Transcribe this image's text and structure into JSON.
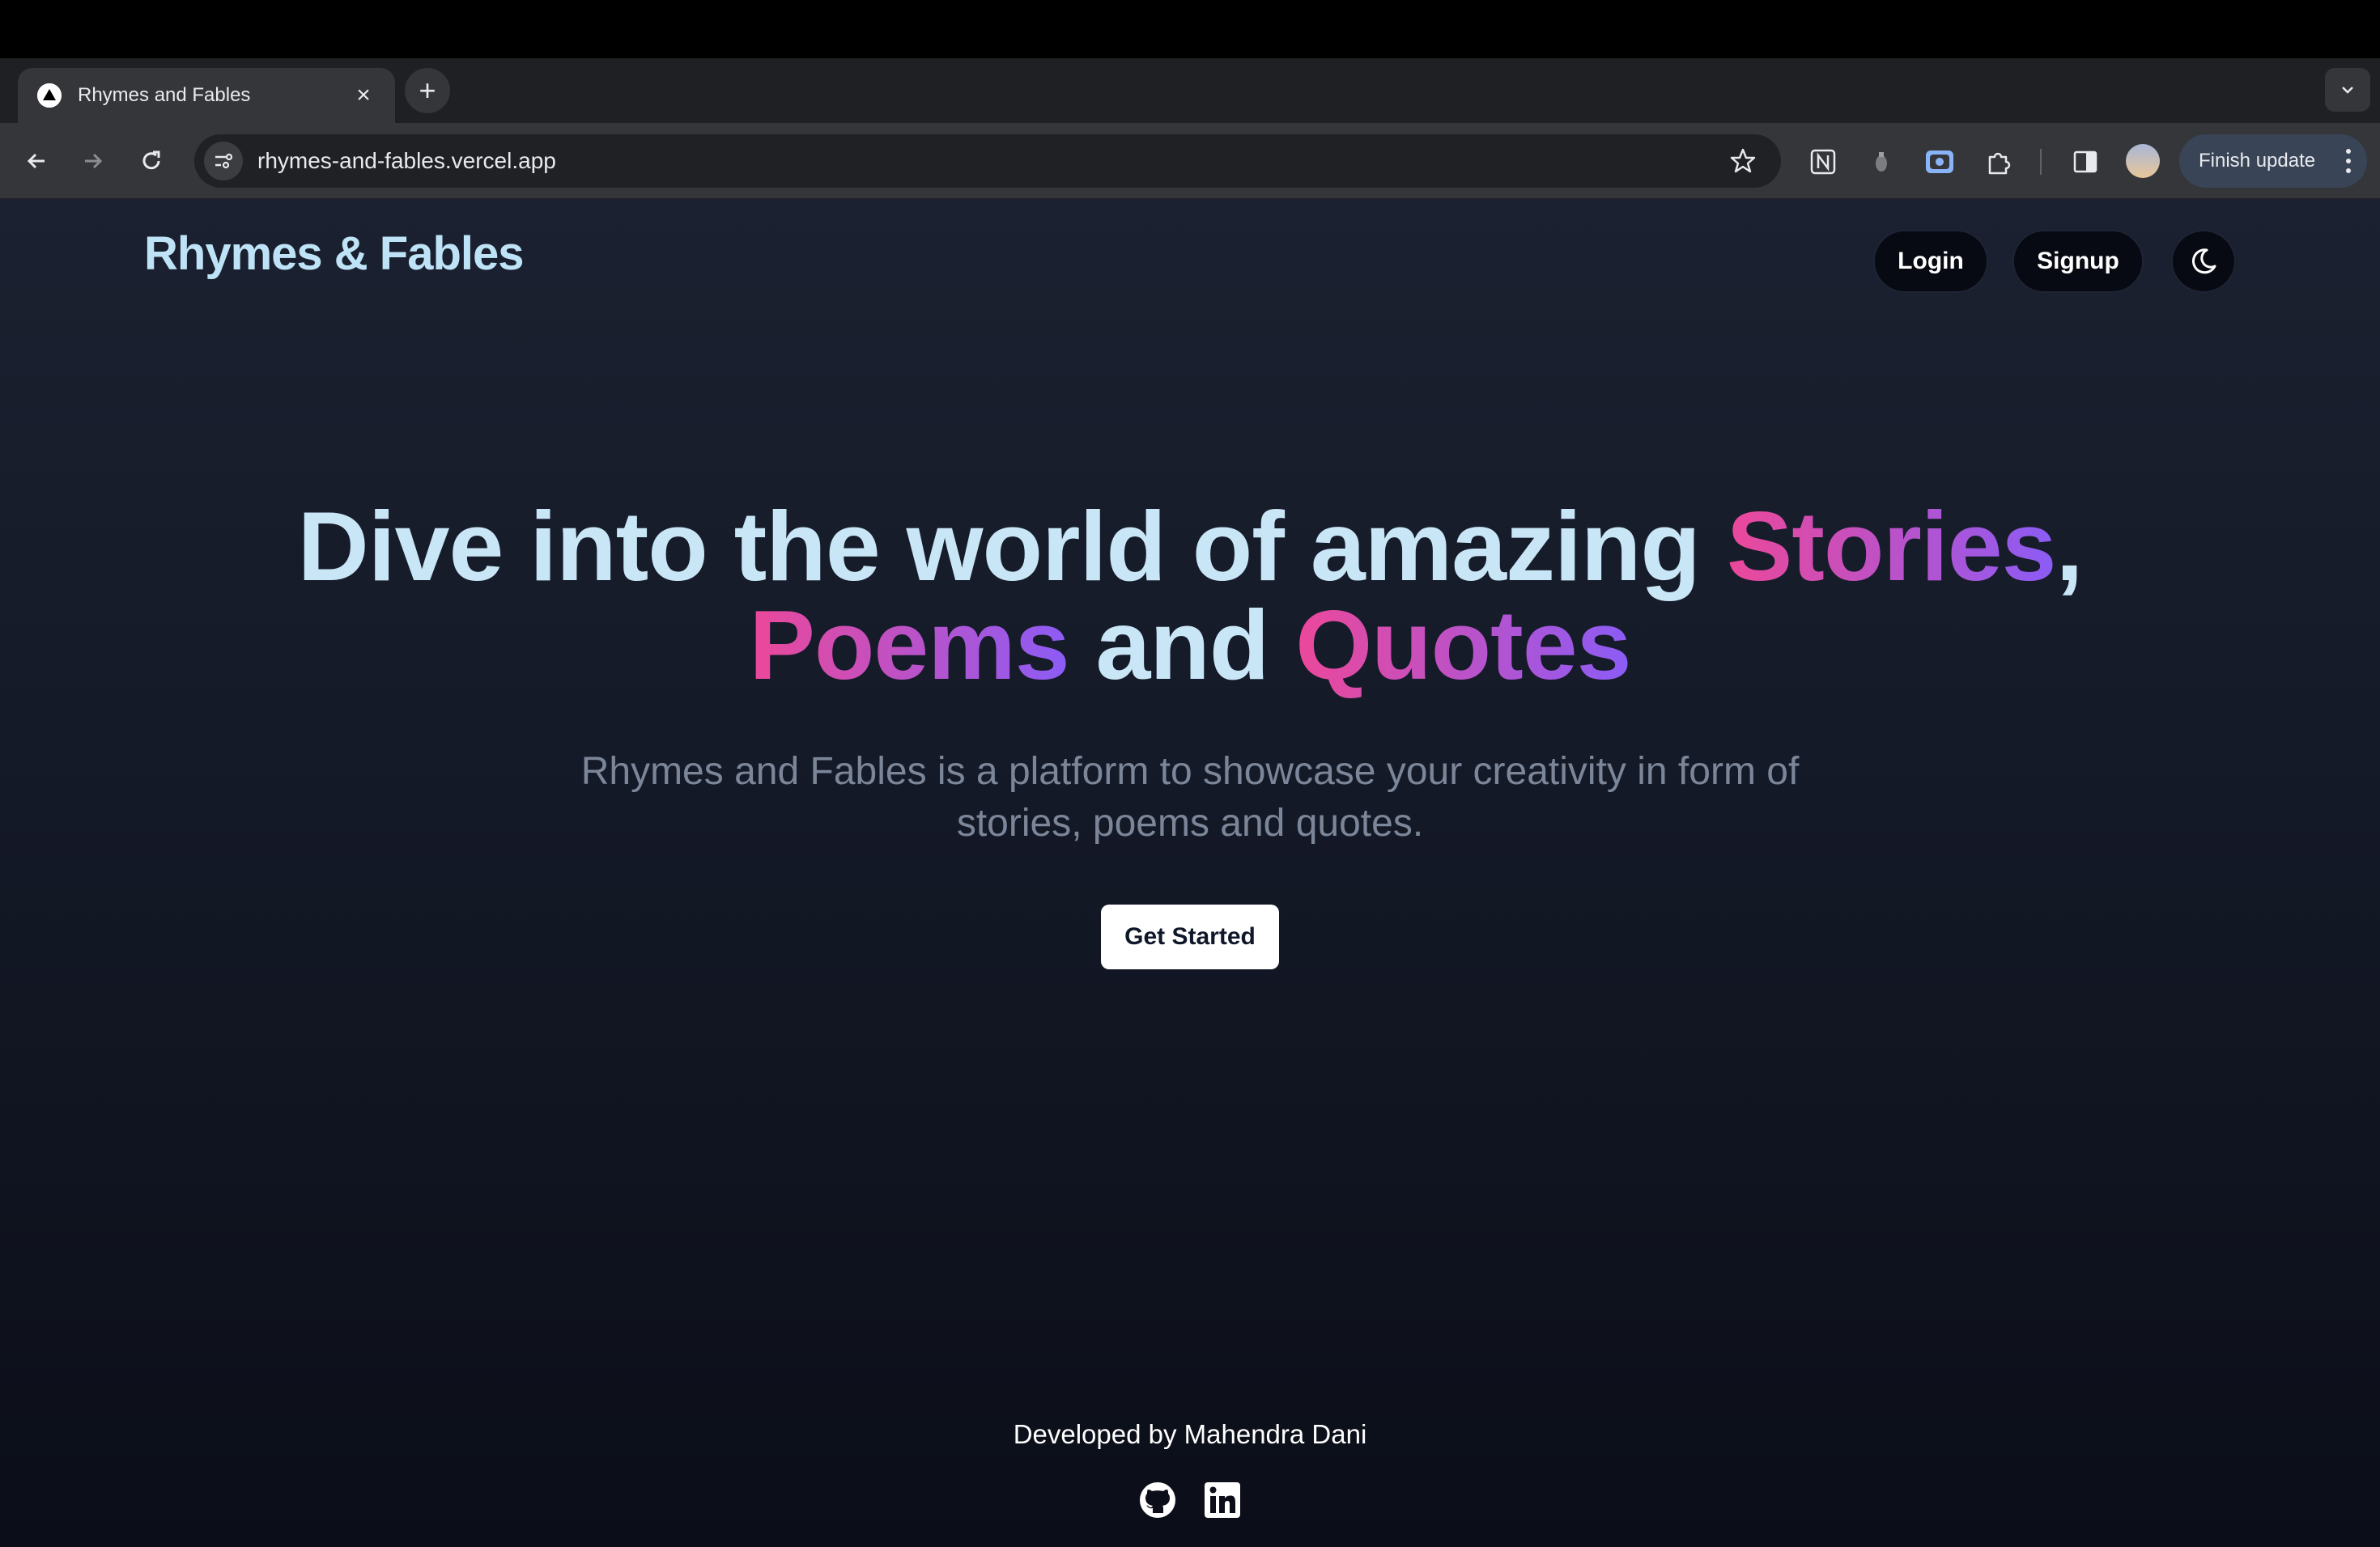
{
  "browser": {
    "tab_title": "Rhymes and Fables",
    "tab_close": "×",
    "new_tab": "+",
    "url": "rhymes-and-fables.vercel.app",
    "update_label": "Finish update"
  },
  "header": {
    "brand": "Rhymes & Fables",
    "login": "Login",
    "signup": "Signup"
  },
  "hero": {
    "line1_plain": "Dive into the world of amazing ",
    "word_stories": "Stories",
    "comma": ",",
    "word_poems": "Poems",
    "and": " and ",
    "word_quotes": "Quotes",
    "subtitle": "Rhymes and Fables is a platform to showcase your creativity in form of stories, poems and quotes.",
    "cta": "Get Started"
  },
  "footer": {
    "credit": "Developed by Mahendra Dani"
  },
  "colors": {
    "gradient_start": "#ec4899",
    "gradient_end": "#8b5cf6",
    "headline": "#c9e6f7",
    "brand": "#bfe3f6"
  }
}
